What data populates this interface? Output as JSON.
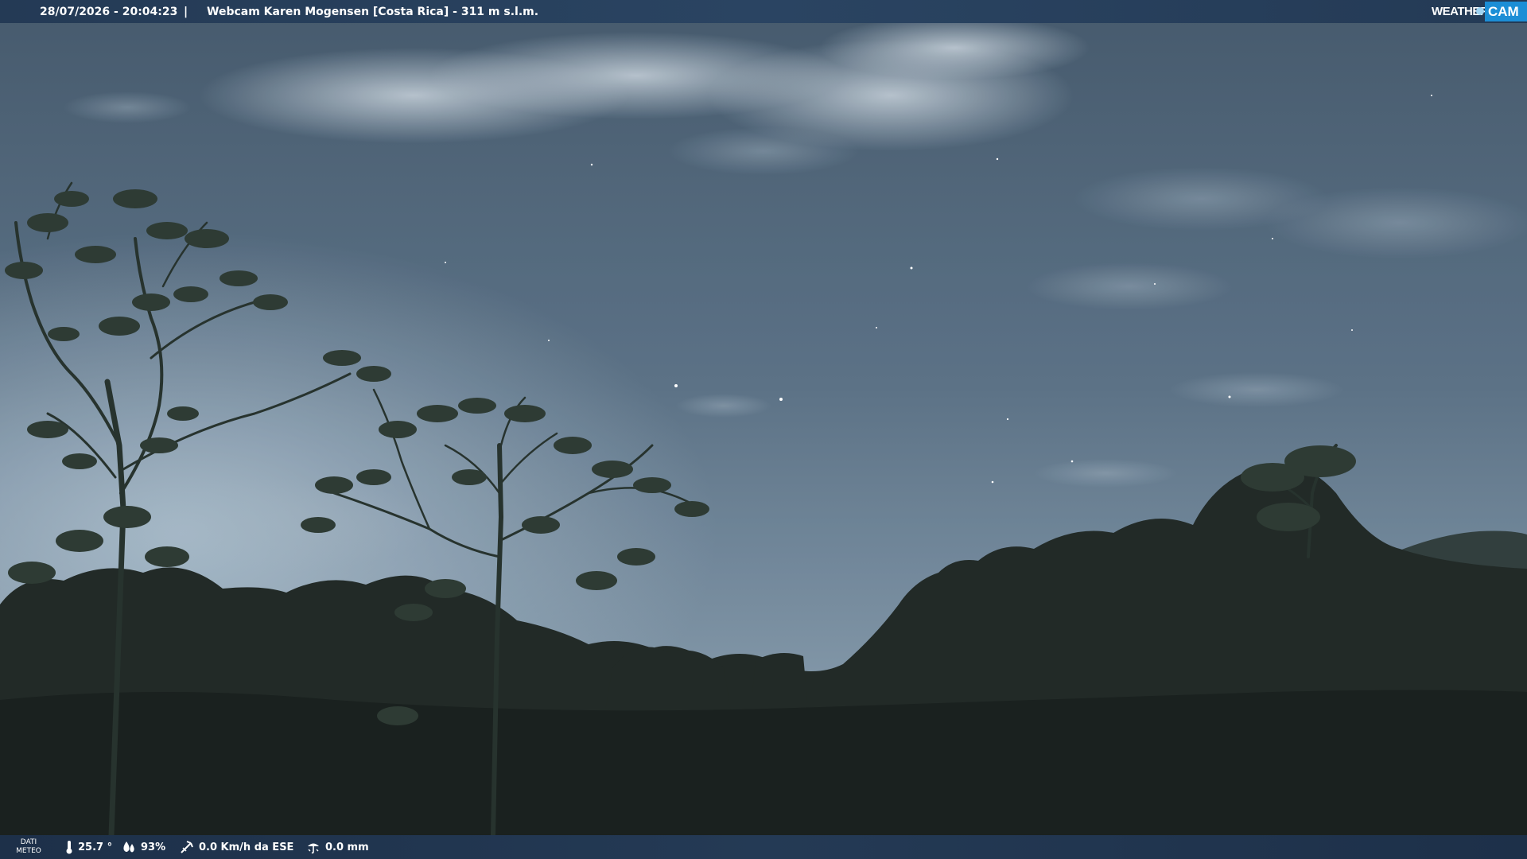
{
  "header": {
    "timestamp": "28/07/2026 - 20:04:23",
    "separator": "|",
    "title": "Webcam Karen Mogensen [Costa Rica] - 311 m s.l.m."
  },
  "logo": {
    "weather": "WEATHER",
    "cam": "CAM"
  },
  "meteo": {
    "label_line1": "DATI",
    "label_line2": "METEO",
    "temperature": "25.7 °",
    "humidity": "93%",
    "wind": "0.0 Km/h da ESE",
    "rain": "0.0 mm"
  },
  "colors": {
    "bar": "#243a55",
    "logo_accent": "#1c8ed6",
    "sky": "#5d7488"
  }
}
